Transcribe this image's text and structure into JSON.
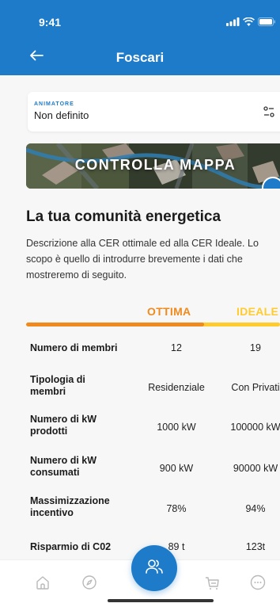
{
  "status_bar": {
    "time": "9:41"
  },
  "header": {
    "title": "Foscari"
  },
  "animatore": {
    "label": "ANIMATORE",
    "value": "Non definito"
  },
  "map_button": {
    "label": "CONTROLLA MAPPA"
  },
  "section": {
    "title": "La tua comunità energetica",
    "description": "Descrizione alla CER ottimale ed alla CER Ideale. Lo scopo è quello di introdurre brevemente i dati che mostreremo di seguito."
  },
  "columns": {
    "ottima": "OTTIMA",
    "ideale": "IDEALE"
  },
  "comparison_progress": 0.7,
  "rows": [
    {
      "label": "Numero di membri",
      "ottima": "12",
      "ideale": "19"
    },
    {
      "label": "Tipologia di membri",
      "ottima": "Residenziale",
      "ideale": "Con Privati"
    },
    {
      "label": "Numero di kW prodotti",
      "ottima": "1000 kW",
      "ideale": "100000 kW"
    },
    {
      "label": "Numero di kW consumati",
      "ottima": "900 kW",
      "ideale": "90000 kW"
    },
    {
      "label": "Massimizzazione incentivo",
      "ottima": "78%",
      "ideale": "94%"
    },
    {
      "label": "Risparmio di C02",
      "ottima": "89 t",
      "ideale": "123t"
    }
  ],
  "colors": {
    "primary": "#1e7bc9",
    "ottima": "#f08a1e",
    "ideale": "#ffcb2e"
  },
  "icons": {
    "back": "arrow-left-icon",
    "filter": "sliders-icon",
    "nav": [
      "home-icon",
      "compass-icon",
      "community-icon",
      "cart-icon",
      "more-icon"
    ]
  }
}
